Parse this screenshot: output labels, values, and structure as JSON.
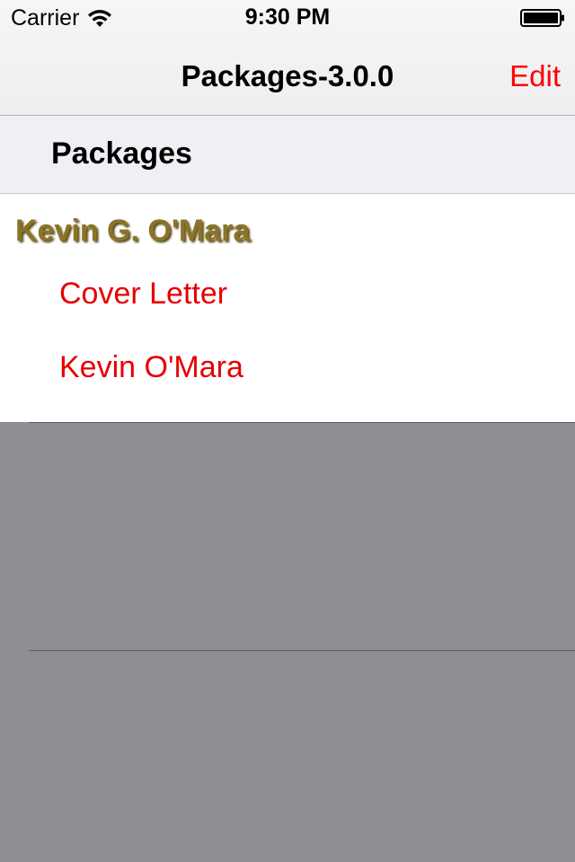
{
  "status_bar": {
    "carrier": "Carrier",
    "time": "9:30 PM",
    "wifi_icon": "wifi-icon",
    "battery_icon": "battery-full-icon"
  },
  "nav_bar": {
    "title": "Packages-3.0.0",
    "edit_label": "Edit"
  },
  "section": {
    "header": "Packages"
  },
  "group": {
    "title": "Kevin G. O'Mara",
    "items": [
      {
        "label": "Cover Letter"
      },
      {
        "label": "Kevin O'Mara"
      }
    ]
  },
  "colors": {
    "accent": "#ff0000",
    "group_title": "#8b7427",
    "background": "#8e8d92",
    "header_background": "#efeff4"
  }
}
